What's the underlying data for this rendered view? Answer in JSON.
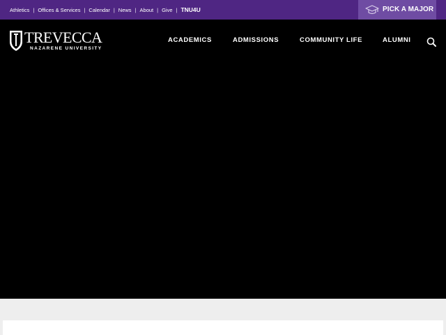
{
  "utility_nav": {
    "links": [
      "Athletics",
      "Offices & Services",
      "Calendar",
      "News",
      "About",
      "Give"
    ],
    "separator": "|",
    "highlight": "TNU4U"
  },
  "pick_major": {
    "label": "PICK A MAJOR",
    "icon": "graduation-cap-icon"
  },
  "logo": {
    "wordmark": "TREVECCA",
    "subtitle": "NAZARENE UNIVERSITY",
    "icon": "shield-icon"
  },
  "main_nav": {
    "items": [
      "ACADEMICS",
      "ADMISSIONS",
      "COMMUNITY LIFE",
      "ALUMNI"
    ]
  },
  "search": {
    "icon": "search-icon"
  },
  "colors": {
    "brand_purple": "#4f2683",
    "button_purple": "#6f4ca3",
    "header_bg": "#000000",
    "band_bg": "#eeeeee"
  }
}
